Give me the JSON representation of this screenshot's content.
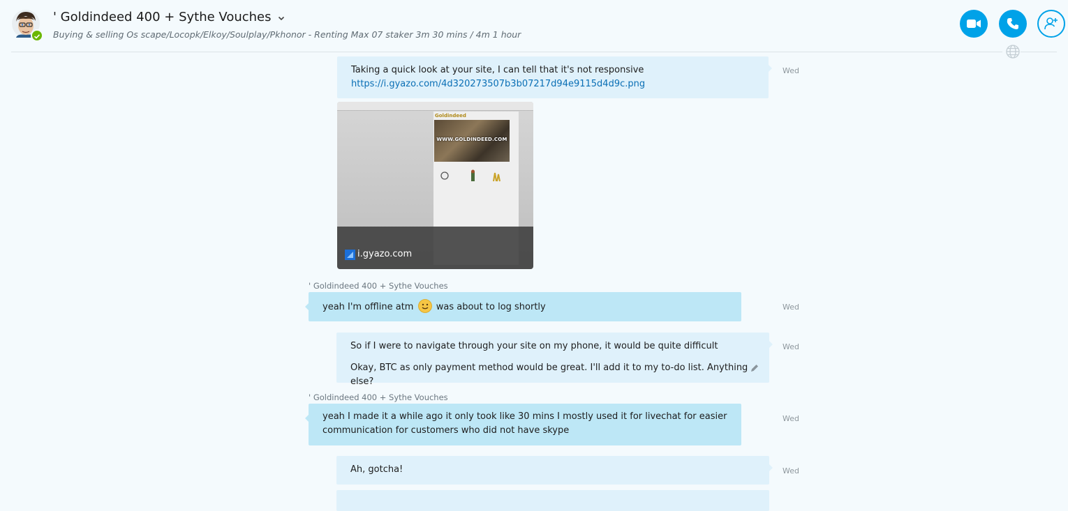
{
  "header": {
    "title": "' Goldindeed 400 + Sythe Vouches",
    "mood": "Buying & selling Os scape/Locopk/Elkoy/Soulplay/Pkhonor - Renting Max 07 staker 3m 30 mins / 4m 1 hour",
    "presence_color": "#6bb700",
    "accent_color": "#00a2e8",
    "icons": [
      "video-call-icon",
      "phone-icon",
      "add-person-icon",
      "globe-icon",
      "chevron-down-icon"
    ]
  },
  "messages": [
    {
      "direction": "outgoing",
      "text": "Taking a quick look at your site, I can tell that it's not responsive",
      "link": "https://i.gyazo.com/4d320273507b3b07217d94e9115d4d9c.png",
      "time": "Wed",
      "preview": {
        "site_logo": "Goldindeed",
        "banner_text": "WWW.GOLDINDEED.COM",
        "caption": "i.gyazo.com"
      }
    },
    {
      "direction": "incoming",
      "sender": "' Goldindeed 400 + Sythe Vouches",
      "text_before": "yeah I'm offline atm",
      "emoji": "smile",
      "text_after": "was about to log shortly",
      "time": "Wed"
    },
    {
      "direction": "outgoing",
      "lines": [
        "So if I were to navigate through your site on my phone, it would be quite difficult",
        "Okay, BTC as only payment method would be great. I'll add it to my to-do list. Anything else?"
      ],
      "time": "Wed"
    },
    {
      "direction": "incoming",
      "sender": "' Goldindeed 400 + Sythe Vouches",
      "lines": [
        "yeah I made it a while ago it only took like 30 mins I mostly used it for livechat for easier",
        "communication for customers who did not have skype"
      ],
      "time": "Wed"
    },
    {
      "direction": "outgoing",
      "text": "Ah, gotcha!",
      "time": "Wed"
    }
  ]
}
